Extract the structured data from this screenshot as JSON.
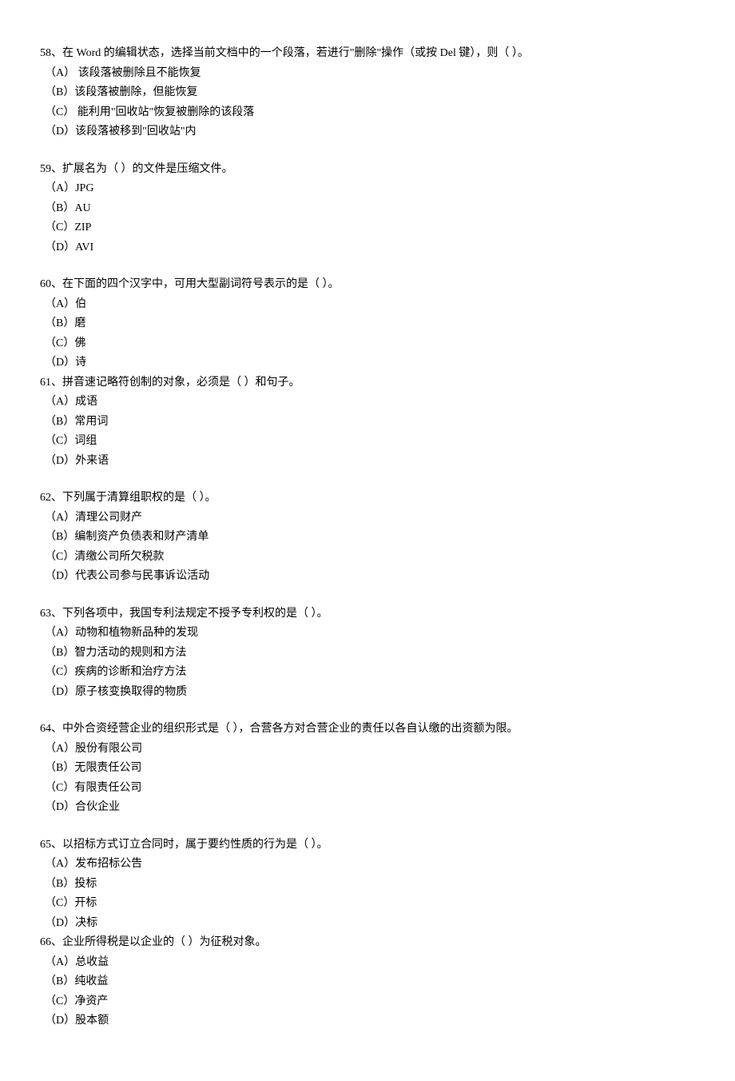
{
  "questions": [
    {
      "id": "q58",
      "text": "58、在 Word 的编辑状态，选择当前文档中的一个段落，若进行\"删除\"操作（或按 Del 键），则（   ）。",
      "options": [
        "（A）  该段落被删除且不能恢复",
        "（B）该段落被删除，但能恢复",
        "（C）  能利用\"回收站\"恢复被删除的该段落",
        "（D）该段落被移到\"回收站\"内"
      ],
      "gap": true
    },
    {
      "id": "q59",
      "text": "59、扩展名为（   ）的文件是压缩文件。",
      "options": [
        "（A）JPG",
        "（B）AU",
        "（C）ZIP",
        "（D）AVI"
      ],
      "gap": true
    },
    {
      "id": "q60",
      "text": "60、在下面的四个汉字中，可用大型副词符号表示的是（   ）。",
      "options": [
        "（A）伯",
        "（B）磨",
        "（C）佛",
        "（D）诗"
      ],
      "gap": false
    },
    {
      "id": "q61",
      "text": "61、拼音速记略符创制的对象，必须是（   ）和句子。",
      "options": [
        "（A）成语",
        "（B）常用词",
        "（C）词组",
        "（D）外来语"
      ],
      "gap": true
    },
    {
      "id": "q62",
      "text": "62、下列属于清算组职权的是（   ）。",
      "options": [
        "（A）清理公司财产",
        "（B）编制资产负债表和财产清单",
        "（C）清缴公司所欠税款",
        "（D）代表公司参与民事诉讼活动"
      ],
      "gap": true
    },
    {
      "id": "q63",
      "text": "63、下列各项中，我国专利法规定不授予专利权的是（   ）。",
      "options": [
        "（A）动物和植物新品种的发现",
        "（B）智力活动的规则和方法",
        "（C）疾病的诊断和治疗方法",
        "（D）原子核变换取得的物质"
      ],
      "gap": true
    },
    {
      "id": "q64",
      "text": "64、中外合资经营企业的组织形式是（   ），合营各方对合营企业的责任以各自认缴的出资额为限。",
      "options": [
        "（A）股份有限公司",
        "（B）无限责任公司",
        "（C）有限责任公司",
        "（D）合伙企业"
      ],
      "gap": true
    },
    {
      "id": "q65",
      "text": "65、以招标方式订立合同时，属于要约性质的行为是（   ）。",
      "options": [
        "（A）发布招标公告",
        "（B）投标",
        "（C）开标",
        "（D）决标"
      ],
      "gap": false
    },
    {
      "id": "q66",
      "text": "66、企业所得税是以企业的（   ）为征税对象。",
      "options": [
        "（A）总收益",
        "（B）纯收益",
        "（C）净资产",
        "（D）股本额"
      ],
      "gap": true
    }
  ]
}
